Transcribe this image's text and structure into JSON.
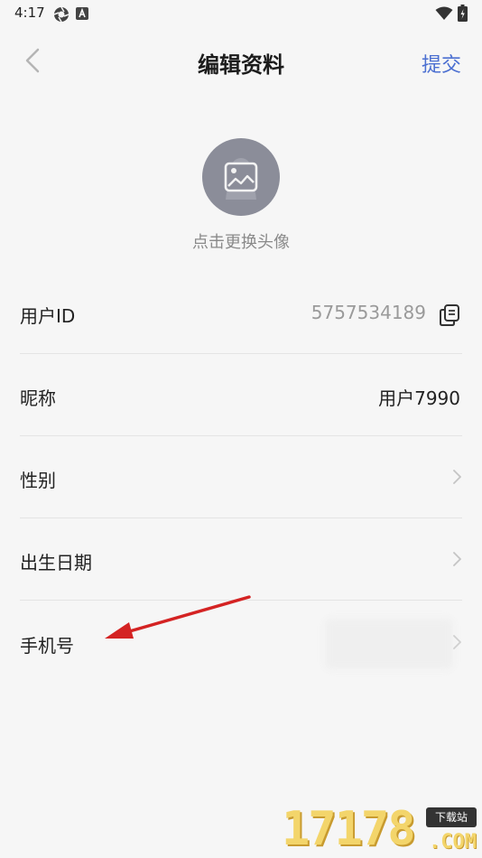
{
  "status_bar": {
    "time": "4:17"
  },
  "header": {
    "title": "编辑资料",
    "submit_label": "提交"
  },
  "avatar": {
    "hint": "点击更换头像"
  },
  "rows": [
    {
      "label": "用户ID",
      "value": "5757534189"
    },
    {
      "label": "昵称",
      "value": "用户7990"
    },
    {
      "label": "性别",
      "value": ""
    },
    {
      "label": "出生日期",
      "value": ""
    },
    {
      "label": "手机号",
      "value": ""
    }
  ],
  "watermark": {
    "number": "17178",
    "badge": "下载站",
    "suffix": ".COM"
  },
  "colors": {
    "accent": "#4b6fd1",
    "background": "#f6f6f6",
    "annotation_arrow": "#d42323",
    "avatar_bg": "#8b8d99"
  },
  "icons": [
    "camera-icon",
    "text-a-icon",
    "wifi-icon",
    "battery-icon",
    "back-chevron-icon",
    "image-placeholder-icon",
    "copy-icon",
    "chevron-right-icon"
  ]
}
